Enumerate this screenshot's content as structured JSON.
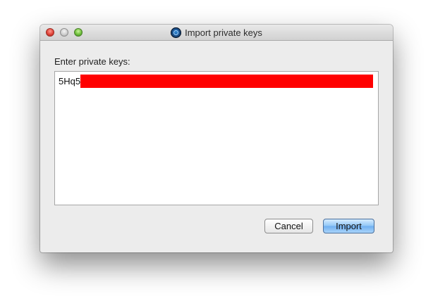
{
  "window": {
    "title": "Import private keys",
    "app_icon": "bitcoin-qt-app-icon",
    "traffic_lights": [
      "close",
      "minimize",
      "zoom"
    ]
  },
  "dialog": {
    "prompt_label": "Enter private keys:",
    "key_input": {
      "visible_prefix": "5Hq5",
      "redaction_color": "#ff0000"
    }
  },
  "buttons": {
    "cancel_label": "Cancel",
    "import_label": "Import",
    "default_button_accent": "#6eaef0"
  }
}
